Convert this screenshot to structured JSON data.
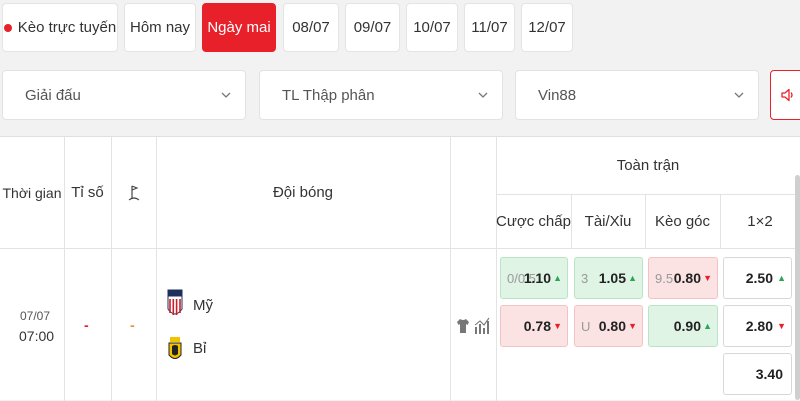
{
  "tabs": [
    {
      "label": "Kèo trực tuyến"
    },
    {
      "label": "Hôm nay"
    },
    {
      "label": "Ngày mai"
    },
    {
      "label": "08/07"
    },
    {
      "label": "09/07"
    },
    {
      "label": "10/07"
    },
    {
      "label": "11/07"
    },
    {
      "label": "12/07"
    }
  ],
  "filters": {
    "league": "Giải đấu",
    "odds_format": "TL Thập phân",
    "bookmaker": "Vin88"
  },
  "table": {
    "header": {
      "time": "Thời gian",
      "score": "Tỉ số",
      "team": "Đội bóng",
      "full_match": "Toàn trận",
      "handicap": "Cược chấp",
      "over_under": "Tài/Xỉu",
      "corner": "Kèo góc",
      "one_x_two": "1×2"
    },
    "match": {
      "date": "07/07",
      "time": "07:00",
      "score": "-",
      "corner_score": "-",
      "home_team": "Mỹ",
      "away_team": "Bỉ",
      "handicap": {
        "line": "0/0.5",
        "home_odd": "1.10",
        "away_odd": "0.78"
      },
      "over_under": {
        "line": "3",
        "over_label": "",
        "over_odd": "1.05",
        "under_label": "U",
        "under_odd": "0.80"
      },
      "corner": {
        "line": "9.5",
        "home_odd": "0.80",
        "away_odd": "0.90"
      },
      "one_x_two": {
        "home": "2.50",
        "away": "2.80",
        "draw": "3.40"
      }
    }
  },
  "colors": {
    "accent": "#e8202a",
    "up": "#2aa655",
    "down": "#e8202a"
  }
}
